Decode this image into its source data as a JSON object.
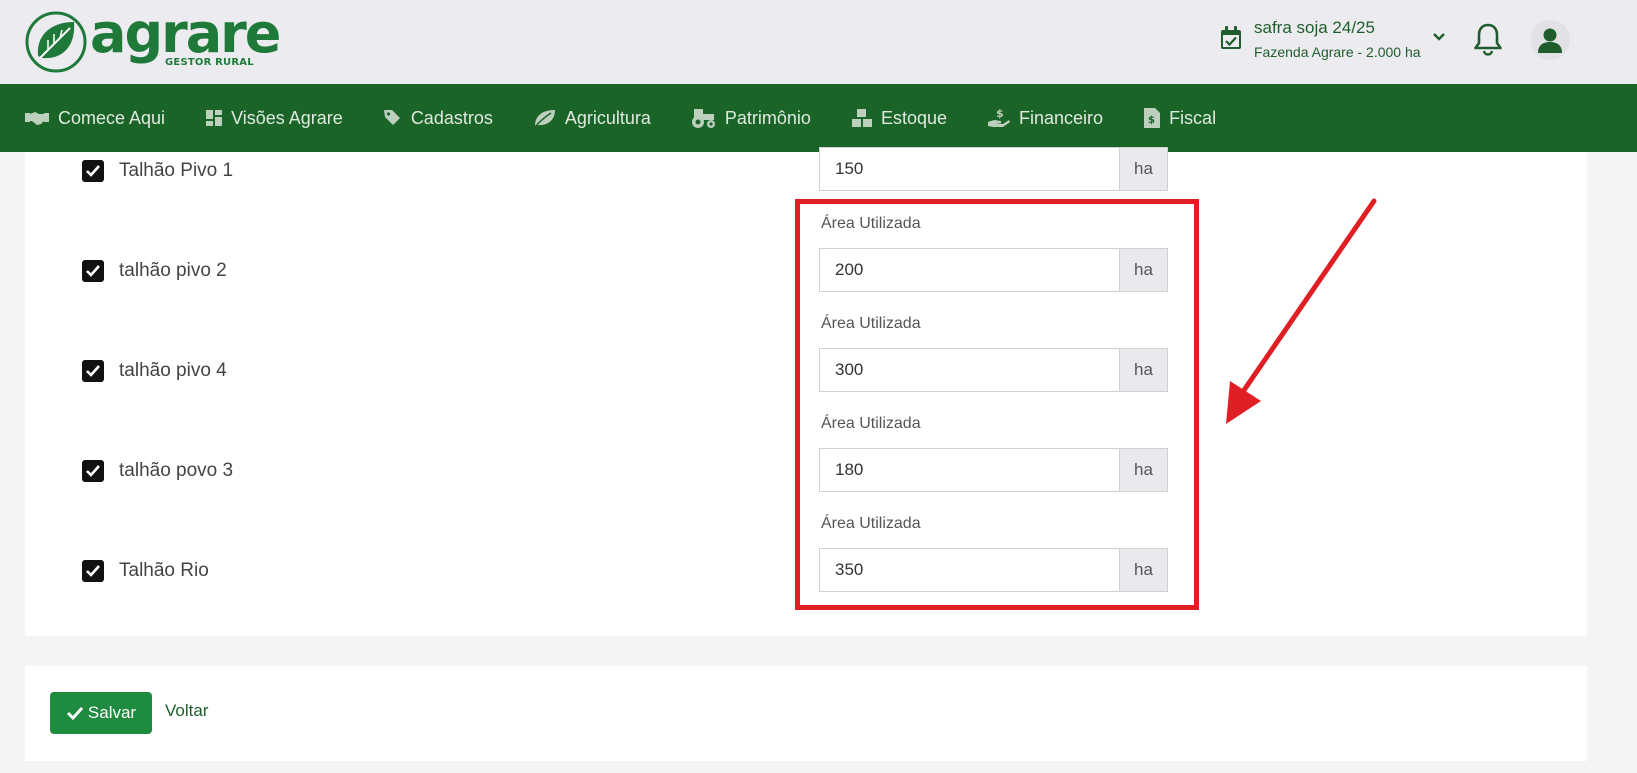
{
  "brand": {
    "name": "agrare",
    "subtitle": "GESTOR RURAL",
    "color": "#1f7a3a"
  },
  "header": {
    "season_title": "safra soja 24/25",
    "season_subtitle": "Fazenda Agrare - 2.000 ha"
  },
  "nav": {
    "items": [
      {
        "label": "Comece Aqui",
        "icon": "handshake-icon"
      },
      {
        "label": "Visões Agrare",
        "icon": "dashboard-icon"
      },
      {
        "label": "Cadastros",
        "icon": "tags-icon"
      },
      {
        "label": "Agricultura",
        "icon": "leaf-icon"
      },
      {
        "label": "Patrimônio",
        "icon": "tractor-icon"
      },
      {
        "label": "Estoque",
        "icon": "boxes-icon"
      },
      {
        "label": "Financeiro",
        "icon": "hand-money-icon"
      },
      {
        "label": "Fiscal",
        "icon": "invoice-icon"
      }
    ],
    "background": "#1b6428"
  },
  "plots": [
    {
      "name": "Talhão Pivo 1",
      "checked": true,
      "area_label": "",
      "area": "150",
      "unit": "ha"
    },
    {
      "name": "talhão pivo 2",
      "checked": true,
      "area_label": "Área Utilizada",
      "area": "200",
      "unit": "ha"
    },
    {
      "name": "talhão pivo 4",
      "checked": true,
      "area_label": "Área Utilizada",
      "area": "300",
      "unit": "ha"
    },
    {
      "name": "talhão povo 3",
      "checked": true,
      "area_label": "Área Utilizada",
      "area": "180",
      "unit": "ha"
    },
    {
      "name": "Talhão Rio",
      "checked": true,
      "area_label": "Área Utilizada",
      "area": "350",
      "unit": "ha"
    }
  ],
  "actions": {
    "save_label": "Salvar",
    "back_label": "Voltar",
    "save_color": "#1e8b3f"
  },
  "annotation": {
    "color": "#e01f25"
  }
}
